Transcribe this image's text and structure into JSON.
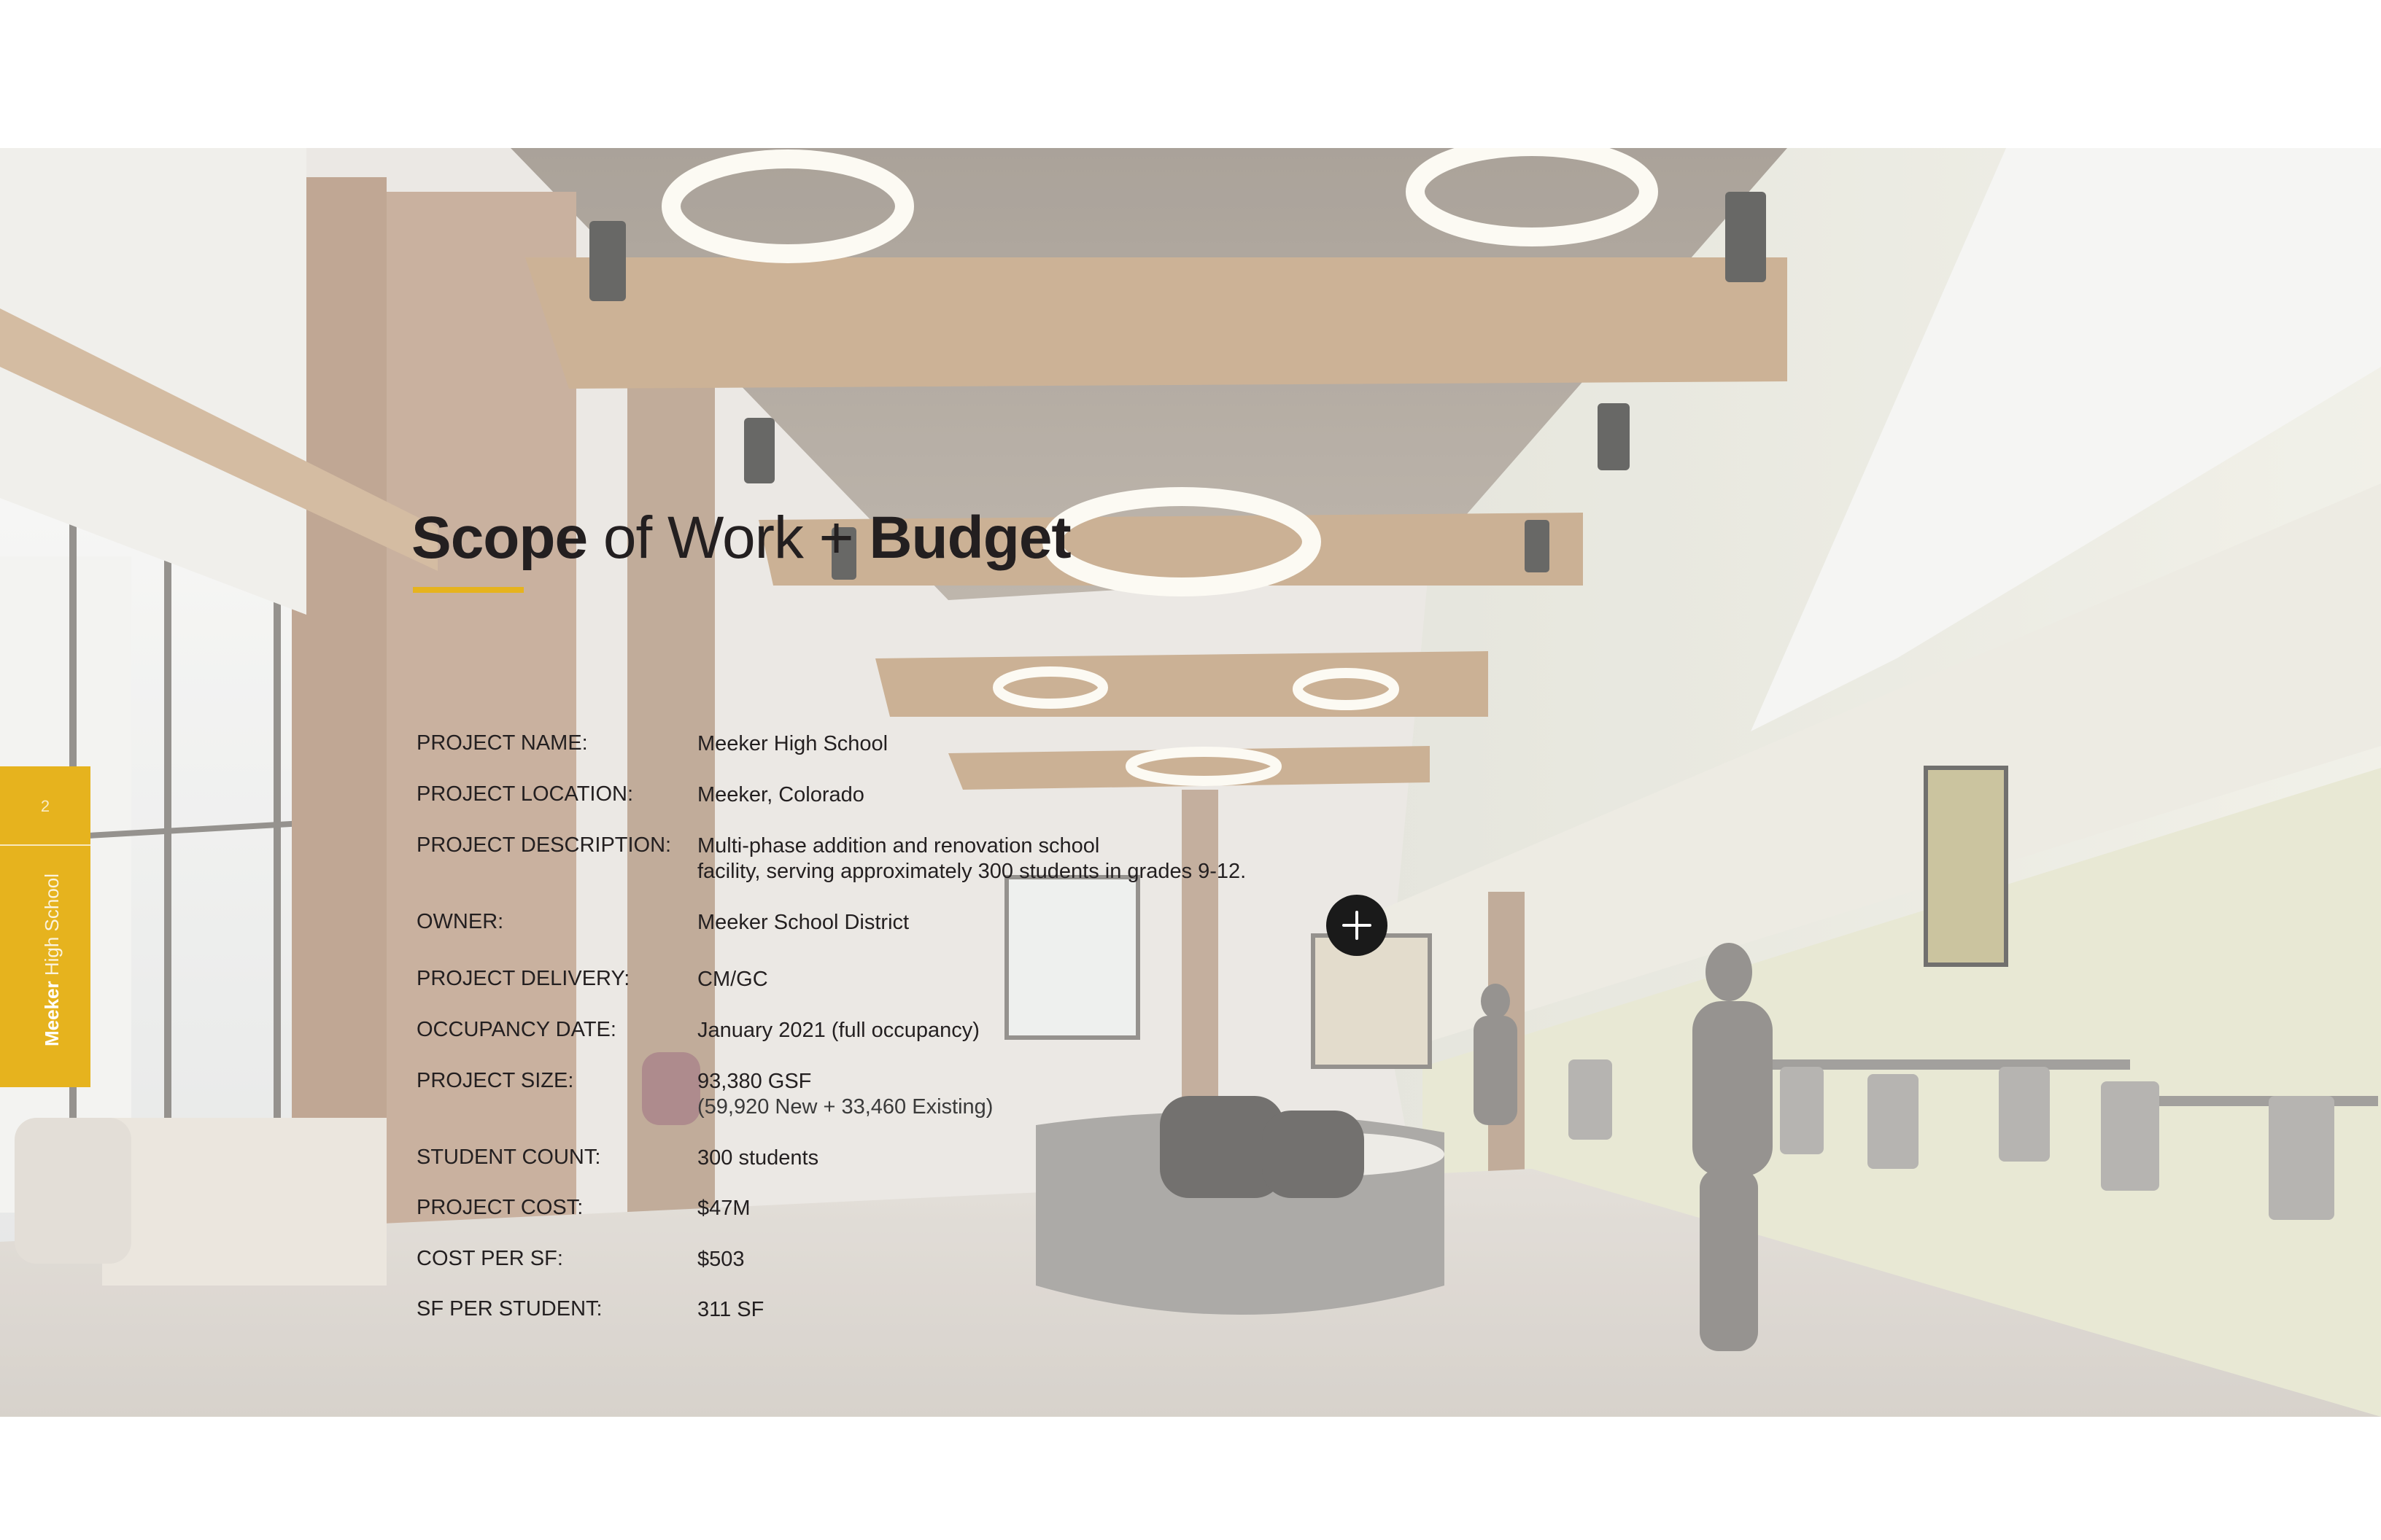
{
  "side_tab": {
    "page_number": "2",
    "label_bold": "Meeker",
    "label_light": " High School",
    "color": "#e6b31e"
  },
  "title": {
    "part1": "Scope",
    "part2": " of Work + ",
    "part3": "Budget"
  },
  "details": [
    {
      "label": "PROJECT NAME:",
      "value": "Meeker High School"
    },
    {
      "label": "PROJECT LOCATION:",
      "value": "Meeker, Colorado"
    },
    {
      "label": "PROJECT DESCRIPTION:",
      "value": "Multi-phase addition and renovation school",
      "value2": "facility, serving approximately 300 students in grades 9-12."
    },
    {
      "label": "OWNER:",
      "value": "Meeker School District"
    },
    {
      "label": "PROJECT DELIVERY:",
      "value": "CM/GC"
    },
    {
      "label": "OCCUPANCY DATE:",
      "value": "January 2021 (full occupancy)"
    },
    {
      "label": "PROJECT SIZE:",
      "value": "93,380 GSF",
      "value2": "(59,920 New + 33,460 Existing)"
    },
    {
      "label": "STUDENT COUNT:",
      "value": "300 students"
    },
    {
      "label": "PROJECT COST:",
      "value": "$47M"
    },
    {
      "label": "COST PER SF:",
      "value": "$503"
    },
    {
      "label": "SF PER STUDENT:",
      "value": "311 SF"
    }
  ],
  "expand_button": {
    "icon": "plus-icon"
  },
  "background_image": {
    "description_icon": "photo-interior-commons"
  }
}
